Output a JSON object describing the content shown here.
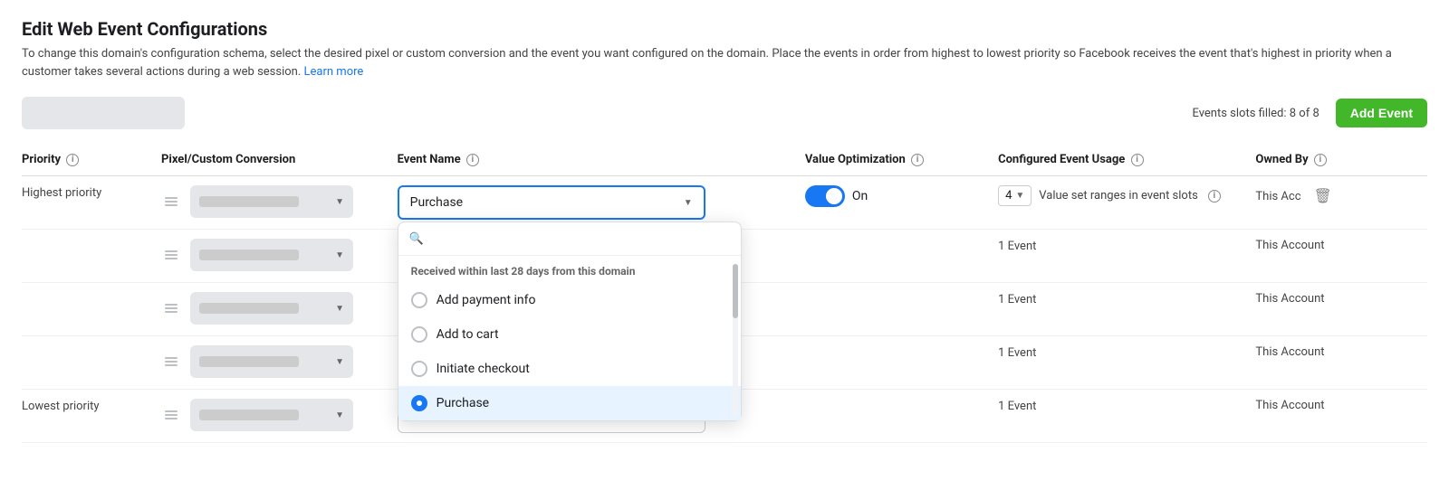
{
  "header": {
    "title": "Edit Web Event Configurations",
    "description": "To change this domain's configuration schema, select the desired pixel or custom conversion and the event you want configured on the domain. Place the events in order from highest to lowest priority so Facebook receives the event that's highest in priority when a customer takes several actions during a web session.",
    "learn_more": "Learn more"
  },
  "toolbar": {
    "events_slots_label": "Events slots filled: 8 of 8",
    "add_event_label": "Add Event"
  },
  "table": {
    "columns": [
      {
        "key": "priority",
        "label": "Priority"
      },
      {
        "key": "pixel",
        "label": "Pixel/Custom Conversion"
      },
      {
        "key": "event_name",
        "label": "Event Name"
      },
      {
        "key": "value_opt",
        "label": "Value Optimization"
      },
      {
        "key": "configured_usage",
        "label": "Configured Event Usage"
      },
      {
        "key": "owned_by",
        "label": "Owned By"
      }
    ],
    "rows": [
      {
        "priority": "Highest priority",
        "event_value": "Purchase",
        "toggle_on": true,
        "toggle_label": "On",
        "num_value": "4",
        "value_ranges_text": "Value set ranges in event slots",
        "owned_by": "This Acc",
        "show_dropdown": true,
        "event_count": ""
      },
      {
        "priority": "",
        "event_value": "",
        "toggle_on": false,
        "event_count": "1 Event",
        "owned_by": "This Account",
        "show_dropdown": false
      },
      {
        "priority": "",
        "event_value": "",
        "toggle_on": false,
        "event_count": "1 Event",
        "owned_by": "This Account",
        "show_dropdown": false
      },
      {
        "priority": "",
        "event_value": "",
        "toggle_on": false,
        "event_count": "1 Event",
        "owned_by": "This Account",
        "show_dropdown": false
      },
      {
        "priority": "Lowest priority",
        "event_value": "",
        "toggle_on": false,
        "event_count": "1 Event",
        "owned_by": "This Account",
        "show_dropdown": false
      }
    ]
  },
  "dropdown": {
    "search_placeholder": "",
    "section_label": "Received within last 28 days from this domain",
    "items": [
      {
        "label": "Add payment info",
        "checked": false
      },
      {
        "label": "Add to cart",
        "checked": false
      },
      {
        "label": "Initiate checkout",
        "checked": false
      },
      {
        "label": "Purchase",
        "checked": true
      }
    ]
  }
}
